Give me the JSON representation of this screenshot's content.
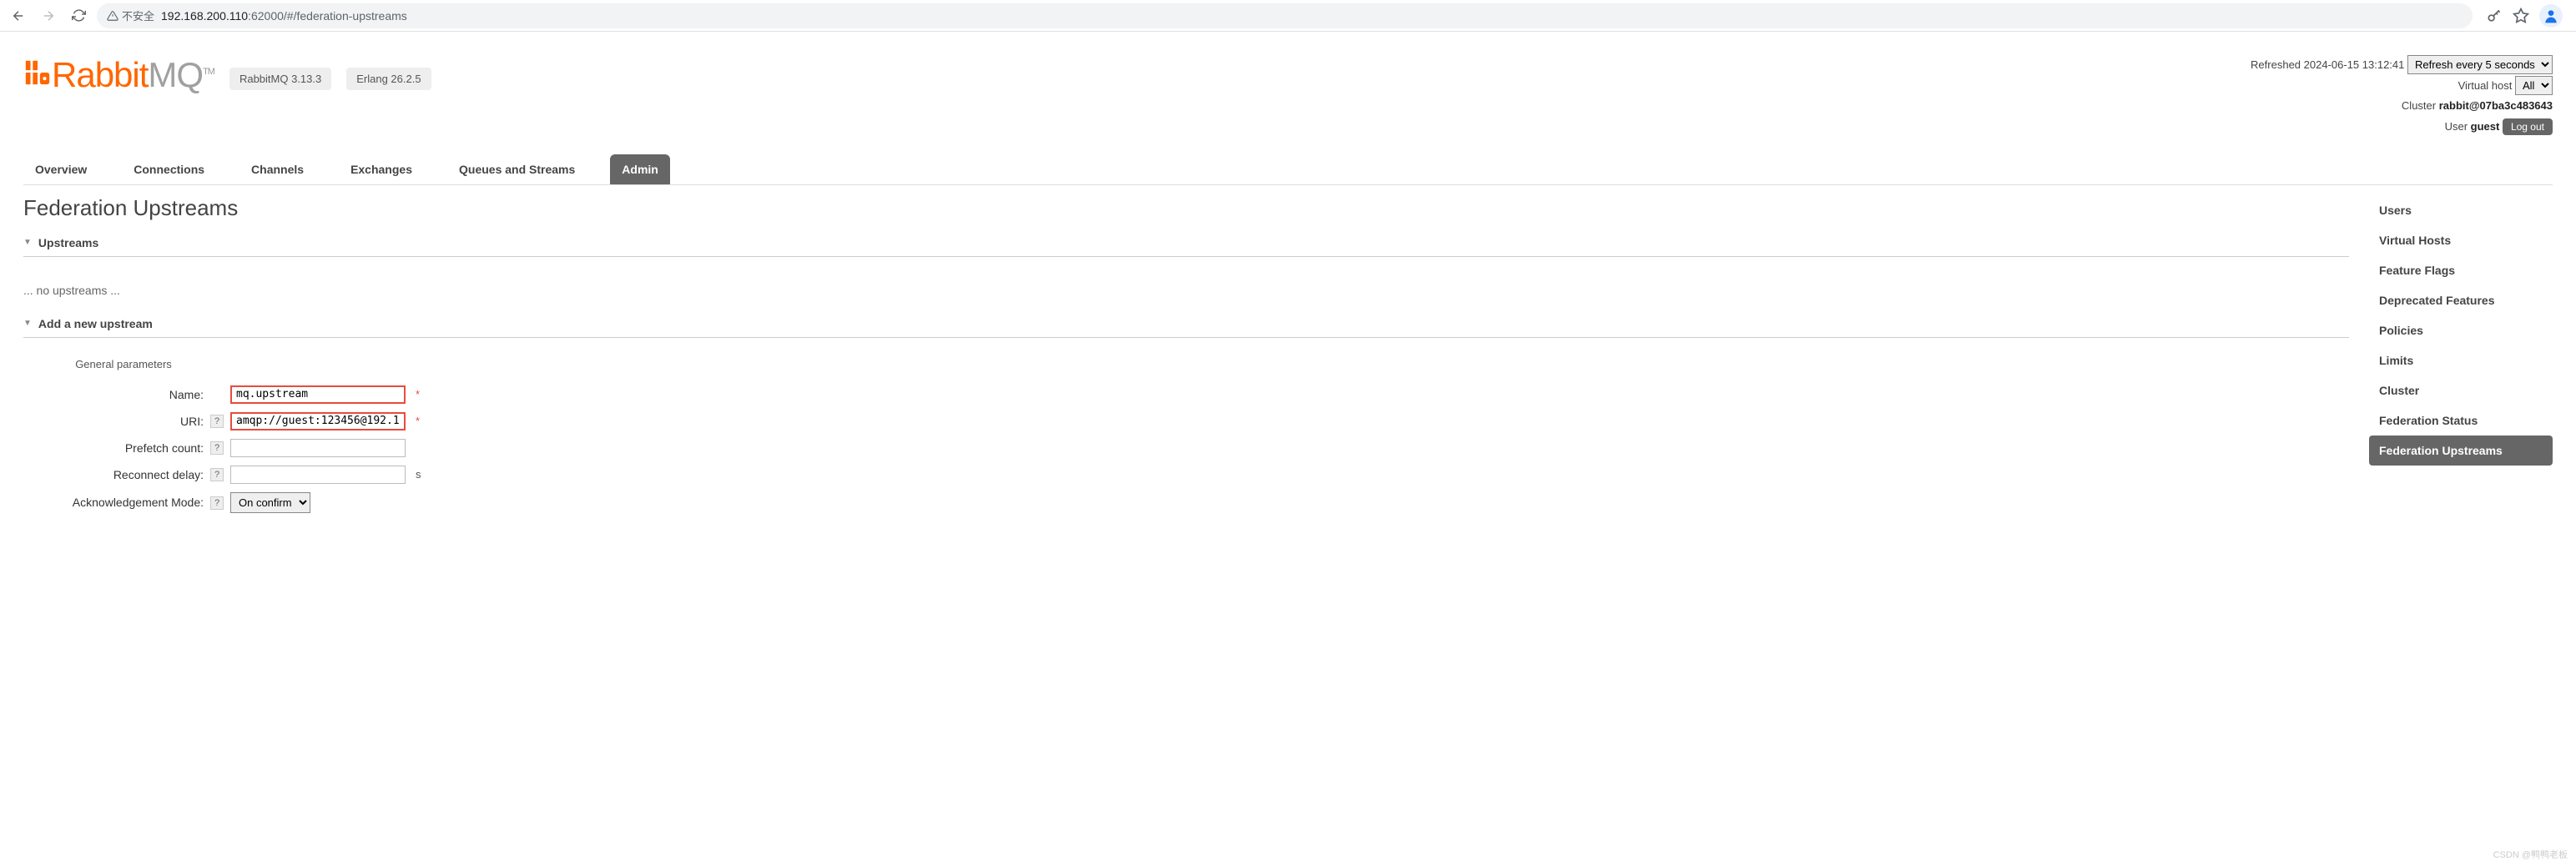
{
  "browser": {
    "warn_text": "不安全",
    "url_host": "192.168.200.110",
    "url_port_path": ":62000/#/federation-upstreams"
  },
  "brand": {
    "name_rabbit": "Rabbit",
    "name_mq": "MQ",
    "tm": "TM",
    "version_app": "RabbitMQ 3.13.3",
    "version_erlang": "Erlang 26.2.5"
  },
  "status": {
    "refreshed_label": "Refreshed",
    "refreshed_time": "2024-06-15 13:12:41",
    "refresh_select": "Refresh every 5 seconds",
    "vhost_label": "Virtual host",
    "vhost_value": "All",
    "cluster_label": "Cluster",
    "cluster_value": "rabbit@07ba3c483643",
    "user_label": "User",
    "user_value": "guest",
    "logout": "Log out"
  },
  "tabs": {
    "items": [
      {
        "label": "Overview"
      },
      {
        "label": "Connections"
      },
      {
        "label": "Channels"
      },
      {
        "label": "Exchanges"
      },
      {
        "label": "Queues and Streams"
      },
      {
        "label": "Admin"
      }
    ]
  },
  "sidebar": {
    "items": [
      {
        "label": "Users"
      },
      {
        "label": "Virtual Hosts"
      },
      {
        "label": "Feature Flags"
      },
      {
        "label": "Deprecated Features"
      },
      {
        "label": "Policies"
      },
      {
        "label": "Limits"
      },
      {
        "label": "Cluster"
      },
      {
        "label": "Federation Status"
      },
      {
        "label": "Federation Upstreams"
      }
    ]
  },
  "page": {
    "title": "Federation Upstreams",
    "section_upstreams": "Upstreams",
    "empty_upstreams": "... no upstreams ...",
    "section_add": "Add a new upstream",
    "general_params": "General parameters",
    "form": {
      "name_label": "Name:",
      "name_value": "mq.upstream",
      "uri_label": "URI:",
      "uri_value": "amqp://guest:123456@192.1",
      "prefetch_label": "Prefetch count:",
      "prefetch_value": "",
      "reconnect_label": "Reconnect delay:",
      "reconnect_value": "",
      "reconnect_unit": "s",
      "ack_label": "Acknowledgement Mode:",
      "ack_value": "On confirm",
      "help": "?"
    }
  },
  "watermark": "CSDN @鸭鸭老板"
}
